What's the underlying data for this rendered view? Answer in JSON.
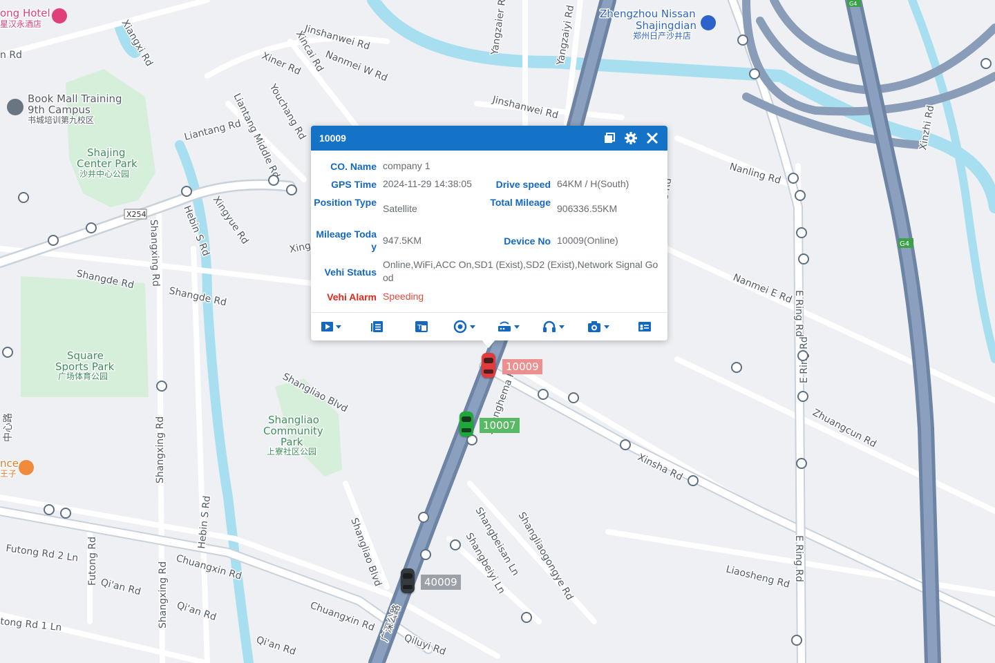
{
  "map": {
    "roads": [
      "Jinshanwei Rd",
      "Nanmei W Rd",
      "Xiner Rd",
      "Xincai Rd",
      "Yangzaier Rd",
      "Yangzaiyi Rd",
      "Youchang Rd",
      "Liantang Middle Rd",
      "Liantang Rd",
      "Xiangxi Rd",
      "Hebin S Rd",
      "Xingyue Rd",
      "Shangde Rd",
      "Shangde Rd",
      "Shangxing Rd",
      "Shangliao Blvd",
      "Nanling Rd",
      "Nanmei E Rd",
      "E Ring Rd",
      "E Ring Rd",
      "Zhuangcun Rd",
      "Xinsha Rd",
      "Liaosheng Rd",
      "E Ring Rd",
      "Shanghema Rd",
      "Shangliaogongye Rd",
      "Shangbeisan Ln",
      "Shangbeiyi Ln",
      "Shangliao Blvd",
      "Chuangxin Rd",
      "Chuangxin Rd",
      "Qilu Rd",
      "Qian Rd",
      "Qian Rd",
      "Qian Rd",
      "Futong Rd",
      "Futong Rd 2 Ln",
      "Shangxing Rd",
      "Hebin S Rd",
      "tong Rd 1 Ln",
      "Xinzhi Rd",
      "S Rd",
      "Jinshanwei Rd",
      "Qiluyi Rd",
      "Xing",
      "n Rd"
    ],
    "road_labels": {
      "jinshanwei_n": "Jinshanwei Rd",
      "nanmei_w": "Nanmei W Rd",
      "xiner": "Xiner Rd",
      "xincai": "Xincai Rd",
      "yangzaier": "Yangzaier Rd",
      "yangzaiyi": "Yangzaiyi Rd",
      "youchang": "Youchang Rd",
      "liantang_middle": "Liantang Middle Rd",
      "liantang": "Liantang Rd",
      "xiangxi": "Xiangxi Rd",
      "hebin_s_top": "Hebin S Rd",
      "xingyue": "Xingyue Rd",
      "shangde_1": "Shangde Rd",
      "shangde_2": "Shangde Rd",
      "shangxing_top": "Shangxing Rd",
      "shangliao_blvd_top": "Shangliao Blvd",
      "nanling": "Nanling Rd",
      "nanmei_e": "Nanmei E Rd",
      "e_ring_1": "E Ring Rd",
      "e_ring_2": "E Ring Rd",
      "zhuangcun": "Zhuangcun Rd",
      "xinsha": "Xinsha Rd",
      "liaosheng": "Liaosheng Rd",
      "e_ring_3": "E Ring Rd",
      "shanghema": "Shanghema Rd",
      "shangliaogongye": "Shangliaogongye Rd",
      "shangbeisan": "Shangbeisan Ln",
      "shangbeiyi": "Shangbeiyi Ln",
      "shangliao_blvd_2": "Shangliao Blvd",
      "chuangxin_1": "Chuangxin Rd",
      "chuangxin_2": "Chuangxin Rd",
      "qiluyi": "Qiluyi Rd",
      "qian_1": "Qi'an Rd",
      "qian_2": "Qi'an Rd",
      "qian_3": "Qi'an Rd",
      "futong": "Futong Rd",
      "futong_2": "Futong Rd 2 Ln",
      "shangxing_bottom": "Shangxing Rd",
      "hebin_s_bottom": "Hebin S Rd",
      "tong_1": "tong Rd 1 Ln",
      "xinzhi": "Xinzhi Rd",
      "jinshanwei_e": "Jinshanwei Rd",
      "s_rd": "S Rd",
      "xing": "Xing",
      "n_rd": "n Rd",
      "guangshen": "广深公路",
      "zhongxin": "中心路",
      "x254": "X254",
      "g4a": "G4",
      "g4b": "G4"
    },
    "pois": {
      "hotel_en": "ong Hotel",
      "hotel_cn": "星汉永酒店",
      "nissan_1": "Zhengzhou Nissan",
      "nissan_2": "Shajingdian",
      "nissan_cn": "郑州日产沙井店",
      "book_1": "Book Mall Training",
      "book_2": "9th Campus",
      "book_cn": "书城培训第九校区",
      "shajing_1": "Shajing",
      "shajing_2": "Center Park",
      "shajing_cn": "沙井中心公园",
      "square_1": "Square",
      "square_2": "Sports Park",
      "square_cn": "广场体育公园",
      "shangliao_1": "Shangliao",
      "shangliao_2": "Community",
      "shangliao_3": "Park",
      "shangliao_cn": "上寮社区公园",
      "food_1": "nce",
      "food_2": "王子"
    }
  },
  "vehicles": [
    {
      "id": "10009",
      "status": "alarm",
      "color": "#e23b3b",
      "tag_color": "#e98a8a"
    },
    {
      "id": "10007",
      "status": "online",
      "color": "#1fa83a",
      "tag_color": "#5ab964"
    },
    {
      "id": "40009",
      "status": "offline",
      "color": "#333a40",
      "tag_color": "#9ba1a6"
    }
  ],
  "popup": {
    "title": "10009",
    "fields": {
      "co_name_label": "CO. Name",
      "co_name": "company 1",
      "gps_time_label": "GPS Time",
      "gps_time": "2024-11-29 14:38:05",
      "drive_speed_label": "Drive speed",
      "drive_speed": "64KM / H(South)",
      "position_type_label": "Position Type",
      "position_type": "Satellite",
      "total_mileage_label": "Total Mileage",
      "total_mileage": "906336.55KM",
      "mileage_today_label": "Mileage Today",
      "mileage_today": "947.5KM",
      "device_no_label": "Device No",
      "device_no": "10009(Online)",
      "vehi_status_label": "Vehi Status",
      "vehi_status": "Online,WiFi,ACC On,SD1 (Exist),SD2 (Exist),Network Signal Good",
      "vehi_alarm_label": "Vehi Alarm",
      "vehi_alarm": "Speeding"
    },
    "toolbar_icons": [
      "video-icon",
      "report-icon",
      "translate-icon",
      "track-icon",
      "device-settings-icon",
      "headset-icon",
      "camera-icon",
      "info-card-icon"
    ]
  }
}
